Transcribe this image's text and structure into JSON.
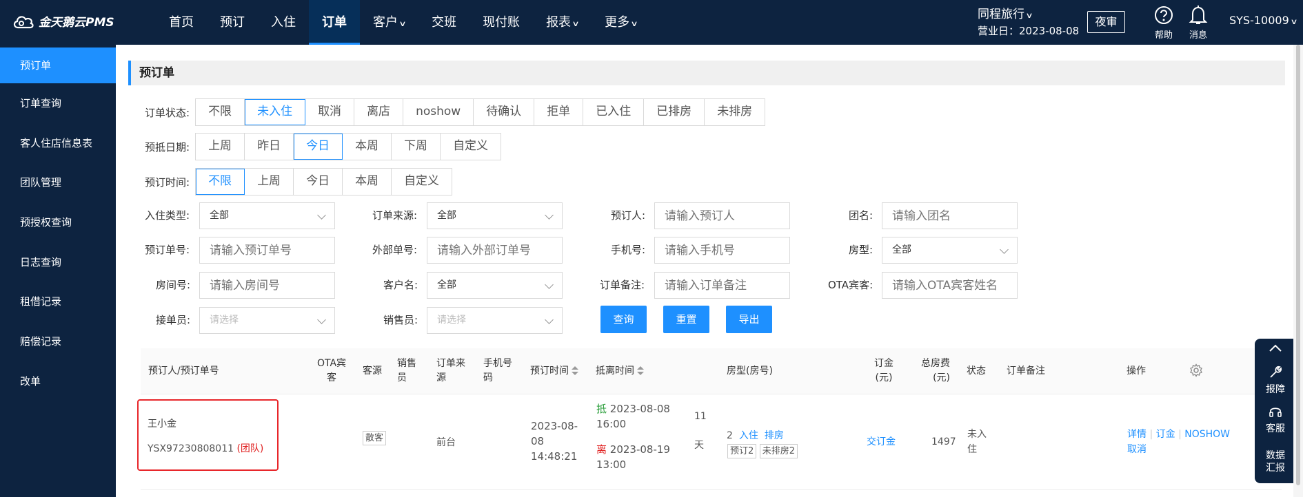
{
  "app": {
    "logo_text": "金天鹅云PMS"
  },
  "nav": [
    {
      "label": "首页"
    },
    {
      "label": "预订"
    },
    {
      "label": "入住"
    },
    {
      "label": "订单"
    },
    {
      "label": "客户"
    },
    {
      "label": "交班"
    },
    {
      "label": "现付账"
    },
    {
      "label": "报表"
    },
    {
      "label": "更多"
    }
  ],
  "header": {
    "hotel_name": "同程旅行",
    "business_date": "营业日：2023-08-08",
    "night_audit": "夜审",
    "help": "帮助",
    "messages": "消息",
    "user": "SYS-10009"
  },
  "sidebar": [
    {
      "label": "预订单"
    },
    {
      "label": "订单查询"
    },
    {
      "label": "客人住店信息表"
    },
    {
      "label": "团队管理"
    },
    {
      "label": "预授权查询"
    },
    {
      "label": "日志查询"
    },
    {
      "label": "租借记录"
    },
    {
      "label": "赔偿记录"
    },
    {
      "label": "改单"
    }
  ],
  "panel_title": "预订单",
  "filters": {
    "status": {
      "label": "订单状态:",
      "options": [
        "不限",
        "未入住",
        "取消",
        "离店",
        "noshow",
        "待确认",
        "拒单",
        "已入住",
        "已排房",
        "未排房"
      ],
      "selected": "未入住"
    },
    "arrival": {
      "label": "预抵日期:",
      "options": [
        "上周",
        "昨日",
        "今日",
        "本周",
        "下周",
        "自定义"
      ],
      "selected": "今日"
    },
    "booking_time": {
      "label": "预订时间:",
      "options": [
        "不限",
        "上周",
        "今日",
        "本周",
        "自定义"
      ],
      "selected": "不限"
    }
  },
  "fields": {
    "checkin_type": {
      "label": "入住类型:",
      "value": "全部"
    },
    "order_source": {
      "label": "订单来源:",
      "value": "全部"
    },
    "booker": {
      "label": "预订人:",
      "placeholder": "请输入预订人"
    },
    "group_name": {
      "label": "团名:",
      "placeholder": "请输入团名"
    },
    "booking_no": {
      "label": "预订单号:",
      "placeholder": "请输入预订单号"
    },
    "external_no": {
      "label": "外部单号:",
      "placeholder": "请输入外部订单号"
    },
    "phone": {
      "label": "手机号:",
      "placeholder": "请输入手机号"
    },
    "room_type": {
      "label": "房型:",
      "value": "全部"
    },
    "room_no": {
      "label": "房间号:",
      "placeholder": "请输入房间号"
    },
    "customer": {
      "label": "客户名:",
      "value": "全部"
    },
    "order_note": {
      "label": "订单备注:",
      "placeholder": "请输入订单备注"
    },
    "ota_guest": {
      "label": "OTA宾客:",
      "placeholder": "请输入OTA宾客姓名"
    },
    "receiver": {
      "label": "接单员:",
      "placeholder": "请选择"
    },
    "sales": {
      "label": "销售员:",
      "placeholder": "请选择"
    }
  },
  "buttons": {
    "query": "查询",
    "reset": "重置",
    "export": "导出"
  },
  "table": {
    "headers": {
      "booker": "预订人/预订单号",
      "ota_l1": "OTA宾",
      "ota_l2": "客",
      "source": "客源",
      "sales_l1": "销售",
      "sales_l2": "员",
      "origin_l1": "订单来",
      "origin_l2": "源",
      "phone_l1": "手机号",
      "phone_l2": "码",
      "booking_time": "预订时间",
      "stay_time": "抵离时间",
      "room": "房型(房号)",
      "deposit_l1": "订金",
      "deposit_l2": "(元)",
      "total_l1": "总房费",
      "total_l2": "(元)",
      "status": "状态",
      "note": "订单备注",
      "ops": "操作"
    },
    "rows": [
      {
        "booker": "王小金",
        "booking_no": "YSX97230808011",
        "group_tag": "(团队)",
        "source": "散客",
        "origin": "前台",
        "booking_time_l1": "2023-08-",
        "booking_time_l2": "08",
        "booking_time_l3": "14:48:21",
        "arrive_tag": "抵",
        "arrive_date": "2023-08-08",
        "arrive_time": "16:00",
        "leave_tag": "离",
        "leave_date": "2023-08-19",
        "leave_time": "13:00",
        "nights": "11",
        "nights_unit": "天",
        "room_count": "2",
        "checkin_link": "入住",
        "assign_link": "排房",
        "tag_booked": "预订2",
        "tag_unassigned": "未排房2",
        "deposit_link": "交订金",
        "total": "1497",
        "status_l1": "未入",
        "status_l2": "住",
        "op_detail": "详情",
        "op_deposit": "订金",
        "op_noshow": "NOSHOW",
        "op_cancel": "取消"
      }
    ]
  },
  "float_bar": {
    "report": "报障",
    "service": "客服",
    "data_l1": "数据",
    "data_l2": "汇报"
  },
  "colors": {
    "nav_bg": "#0d2340",
    "accent": "#1e90ff",
    "highlight": "#e8262a"
  }
}
